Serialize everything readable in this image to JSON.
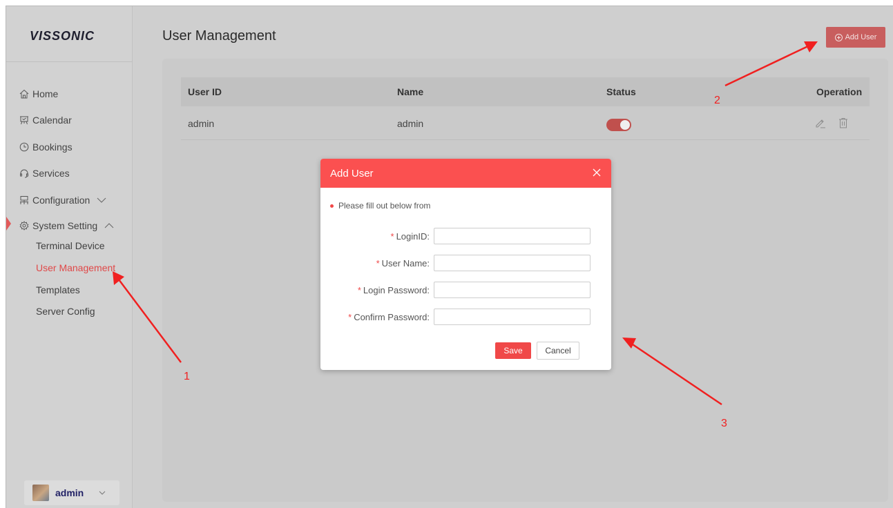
{
  "brand": {
    "logo": "VISSONIC"
  },
  "sidebar": {
    "items": [
      {
        "label": "Home",
        "icon": "home-icon"
      },
      {
        "label": "Calendar",
        "icon": "calendar-icon"
      },
      {
        "label": "Bookings",
        "icon": "clock-icon"
      },
      {
        "label": "Services",
        "icon": "headset-icon"
      },
      {
        "label": "Configuration",
        "icon": "network-icon",
        "expandable": true
      },
      {
        "label": "System Setting",
        "icon": "gear-icon",
        "expanded": true
      }
    ],
    "sub_items": [
      {
        "label": "Terminal Device"
      },
      {
        "label": "User Management",
        "active": true
      },
      {
        "label": "Templates"
      },
      {
        "label": "Server Config"
      }
    ],
    "user": {
      "name": "admin"
    }
  },
  "header": {
    "title": "User Management",
    "add_user_label": "Add User"
  },
  "table": {
    "columns": [
      "User ID",
      "Name",
      "Status",
      "Operation"
    ],
    "rows": [
      {
        "user_id": "admin",
        "name": "admin",
        "status_on": true
      }
    ]
  },
  "dialog": {
    "title": "Add User",
    "note": "Please fill out below from",
    "fields": [
      {
        "label": "LoginID:",
        "value": ""
      },
      {
        "label": "User Name:",
        "value": ""
      },
      {
        "label": "Login Password:",
        "value": ""
      },
      {
        "label": "Confirm Password:",
        "value": ""
      }
    ],
    "save_label": "Save",
    "cancel_label": "Cancel"
  },
  "annotations": [
    "1",
    "2",
    "3"
  ],
  "colors": {
    "accent": "#fb5050",
    "active_text": "#e04848",
    "toggle_on": "#c0504d",
    "arrow": "#f02020"
  }
}
